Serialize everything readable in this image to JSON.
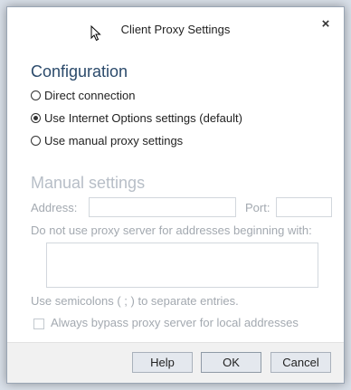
{
  "window": {
    "title": "Client Proxy Settings",
    "close_glyph": "×"
  },
  "configuration": {
    "heading": "Configuration",
    "options": [
      {
        "label": "Direct connection",
        "checked": false
      },
      {
        "label": "Use Internet Options settings (default)",
        "checked": true
      },
      {
        "label": "Use manual proxy settings",
        "checked": false
      }
    ]
  },
  "manual": {
    "heading": "Manual settings",
    "address_label": "Address:",
    "address_value": "",
    "port_label": "Port:",
    "port_value": "",
    "exceptions_label": "Do not use proxy server for addresses beginning with:",
    "exceptions_value": "",
    "semicolon_note": "Use semicolons ( ; ) to separate entries.",
    "bypass_label": "Always bypass proxy server for local addresses",
    "bypass_checked": false
  },
  "buttons": {
    "help": "Help",
    "ok": "OK",
    "cancel": "Cancel"
  },
  "icons": {
    "close": "close-icon",
    "cursor": "mouse-pointer-icon"
  }
}
